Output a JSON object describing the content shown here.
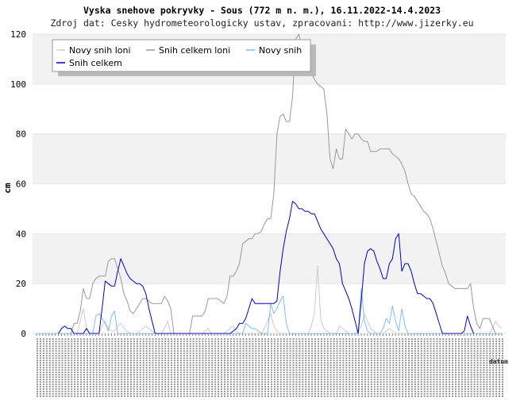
{
  "chart_data": {
    "type": "line",
    "title": "Vyska snehove pokryvky - Sous (772 m n. m.), 16.11.2022-14.4.2023",
    "subtitle": "Zdroj dat: Cesky hydrometeorologicky ustav, zpracovani: http://www.jizerky.eu",
    "ylabel": "cm",
    "xlabel": "datum",
    "ylim": [
      0,
      120
    ],
    "yticks": [
      0,
      20,
      40,
      60,
      80,
      100,
      120
    ],
    "grid": true,
    "legend_position": "top-left",
    "x_count": 150,
    "series": [
      {
        "name": "Novy snih loni",
        "color": "#cccccc",
        "values": [
          0,
          0,
          0,
          0,
          0,
          0,
          0,
          0,
          0,
          0,
          0,
          0,
          0,
          0,
          5,
          10,
          2,
          0,
          0,
          0,
          0,
          3,
          5,
          2,
          1,
          1,
          3,
          4,
          2,
          1,
          0,
          0,
          0,
          1,
          2,
          3,
          2,
          1,
          0,
          0,
          0,
          2,
          5,
          0,
          0,
          0,
          0,
          0,
          0,
          0,
          0,
          0,
          0,
          0,
          1,
          2,
          0,
          0,
          0,
          0,
          0,
          1,
          2,
          3,
          1,
          0,
          0,
          0,
          0,
          0,
          0,
          0,
          0,
          2,
          5,
          8,
          3,
          1,
          0,
          0,
          0,
          0,
          0,
          0,
          0,
          0,
          0,
          0,
          3,
          8,
          27,
          6,
          2,
          1,
          0,
          0,
          0,
          3,
          2,
          1,
          0,
          0,
          0,
          1,
          3,
          8,
          5,
          2,
          1,
          0,
          0,
          0,
          1,
          2,
          1,
          0,
          0,
          0,
          0,
          0,
          0,
          0,
          0,
          0,
          0,
          0,
          0,
          0,
          0,
          0,
          0,
          0,
          0,
          0,
          0,
          0,
          0,
          0,
          0,
          0,
          0,
          0,
          0,
          0,
          0,
          0,
          2,
          5,
          3,
          2
        ]
      },
      {
        "name": "Snih celkem loni",
        "color": "#999999",
        "values": [
          0,
          0,
          0,
          0,
          0,
          0,
          0,
          0,
          0,
          0,
          0,
          0,
          4,
          4,
          9,
          18,
          14,
          14,
          20,
          22,
          23,
          23,
          23,
          29,
          30,
          30,
          26,
          22,
          16,
          13,
          9,
          8,
          10,
          12,
          14,
          14,
          13,
          12,
          12,
          12,
          12,
          15,
          13,
          10,
          0,
          0,
          0,
          0,
          0,
          0,
          7,
          7,
          7,
          7,
          9,
          14,
          14,
          14,
          14,
          13,
          12,
          15,
          23,
          23,
          25,
          28,
          36,
          37,
          38,
          38,
          40,
          40,
          41,
          44,
          46,
          46,
          56,
          80,
          87,
          88,
          85,
          85,
          95,
          118,
          120,
          115,
          110,
          108,
          104,
          102,
          100,
          99,
          98,
          88,
          70,
          66,
          74,
          70,
          70,
          82,
          80,
          78,
          80,
          80,
          78,
          77,
          77,
          73,
          73,
          73,
          74,
          74,
          74,
          74,
          72,
          71,
          70,
          68,
          65,
          60,
          56,
          55,
          53,
          51,
          49,
          48,
          46,
          42,
          37,
          32,
          27,
          24,
          20,
          19,
          18,
          18,
          18,
          18,
          18,
          20,
          10,
          4,
          2,
          6,
          6,
          6,
          3,
          0
        ]
      },
      {
        "name": "Novy snih",
        "color": "#7ec0ea",
        "values": [
          0,
          0,
          0,
          0,
          0,
          0,
          0,
          0,
          0,
          0,
          0,
          0,
          0,
          0,
          0,
          0,
          0,
          0,
          0,
          7,
          8,
          6,
          4,
          1,
          7,
          9,
          0,
          0,
          0,
          0,
          0,
          0,
          0,
          0,
          0,
          0,
          0,
          0,
          0,
          0,
          0,
          0,
          0,
          0,
          0,
          0,
          0,
          0,
          0,
          0,
          0,
          0,
          0,
          0,
          0,
          0,
          0,
          0,
          0,
          0,
          0,
          0,
          0,
          0,
          0,
          0,
          0,
          4,
          3,
          2,
          2,
          1,
          0,
          0,
          0,
          12,
          8,
          10,
          13,
          15,
          4,
          0,
          0,
          0,
          0,
          0,
          0,
          0,
          0,
          0,
          0,
          0,
          0,
          0,
          0,
          0,
          0,
          0,
          0,
          0,
          0,
          0,
          0,
          0,
          18,
          5,
          1,
          0,
          0,
          0,
          0,
          2,
          6,
          4,
          11,
          5,
          1,
          10,
          3,
          0,
          0,
          0,
          0,
          0,
          0,
          0,
          0,
          0,
          0,
          0,
          0,
          0,
          0,
          0,
          0,
          0,
          0,
          0,
          0,
          0,
          0,
          0,
          0,
          0,
          0,
          0,
          0,
          0,
          0,
          0
        ]
      },
      {
        "name": "Snih celkem",
        "color": "#0000cc",
        "values": [
          null,
          null,
          null,
          null,
          null,
          null,
          null,
          0,
          2,
          3,
          2,
          2,
          0,
          0,
          0,
          0,
          2,
          0,
          0,
          0,
          0,
          10,
          21,
          20,
          19,
          19,
          25,
          30,
          27,
          24,
          22,
          21,
          20,
          20,
          19,
          16,
          10,
          5,
          0,
          0,
          0,
          0,
          0,
          0,
          0,
          0,
          0,
          0,
          0,
          0,
          0,
          0,
          0,
          0,
          0,
          0,
          0,
          0,
          0,
          0,
          0,
          0,
          0,
          1,
          2,
          4,
          4,
          6,
          10,
          14,
          12,
          12,
          12,
          12,
          12,
          12,
          12,
          13,
          25,
          34,
          41,
          46,
          53,
          52,
          50,
          50,
          49,
          49,
          48,
          48,
          45,
          42,
          40,
          38,
          36,
          34,
          30,
          28,
          20,
          17,
          14,
          10,
          5,
          0,
          13,
          28,
          33,
          34,
          33,
          29,
          26,
          22,
          22,
          28,
          30,
          38,
          40,
          25,
          28,
          28,
          25,
          20,
          16,
          16,
          15,
          14,
          14,
          12,
          8,
          4,
          0,
          0,
          0,
          0,
          0,
          0,
          0,
          1,
          7,
          3,
          0,
          null,
          null,
          null,
          null,
          null,
          null,
          null,
          null,
          null,
          null,
          null
        ]
      }
    ]
  }
}
